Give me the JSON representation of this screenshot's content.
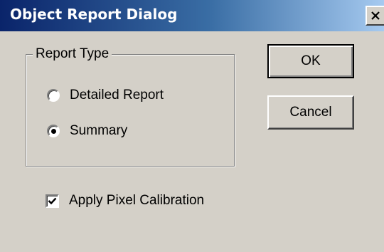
{
  "window": {
    "title": "Object Report Dialog",
    "close_icon": "close-icon",
    "title_bar_colors": [
      "#0a246a",
      "#a6caf0"
    ]
  },
  "report_type": {
    "group_label": "Report Type",
    "options": [
      {
        "label": "Detailed Report",
        "selected": false
      },
      {
        "label": "Summary",
        "selected": true
      }
    ]
  },
  "calibration": {
    "label": "Apply Pixel Calibration",
    "checked": true
  },
  "buttons": {
    "ok_label": "OK",
    "cancel_label": "Cancel"
  }
}
